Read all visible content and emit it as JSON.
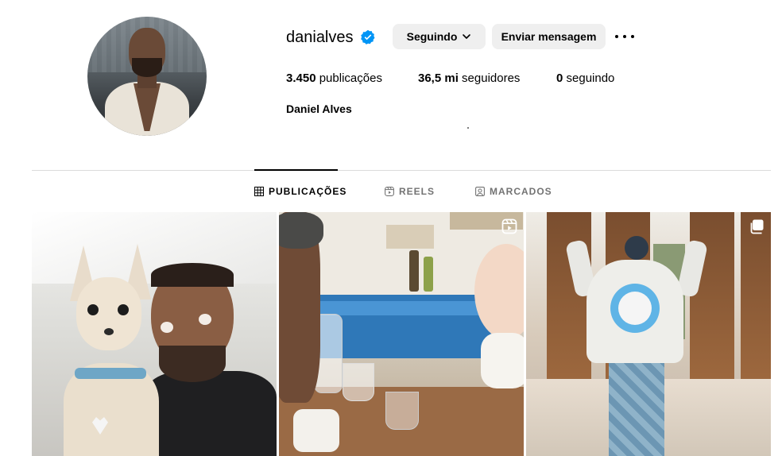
{
  "profile": {
    "username": "danialves",
    "full_name": "Daniel Alves",
    "verified": true,
    "verified_icon": "verified-badge-icon",
    "verified_color": "#0095f6",
    "avatar_icon": "profile-avatar"
  },
  "actions": {
    "following_label": "Seguindo",
    "message_label": "Enviar mensagem",
    "more_icon": "more-options-icon"
  },
  "stats": {
    "posts_value": "3.450",
    "posts_label": "publicações",
    "followers_value": "36,5 mi",
    "followers_label": "seguidores",
    "following_value": "0",
    "following_label": "seguindo"
  },
  "tabs": [
    {
      "label": "PUBLICAÇÕES",
      "icon": "grid-icon",
      "active": true
    },
    {
      "label": "REELS",
      "icon": "reels-icon",
      "active": false
    },
    {
      "label": "MARCADOS",
      "icon": "tagged-icon",
      "active": false
    }
  ],
  "posts": [
    {
      "type": "photo",
      "icon": null
    },
    {
      "type": "reel",
      "icon": "reel-badge-icon"
    },
    {
      "type": "carousel",
      "icon": "carousel-badge-icon"
    }
  ],
  "colors": {
    "button_bg": "#efefef",
    "divider": "#dbdbdb",
    "tab_inactive": "#737373"
  }
}
